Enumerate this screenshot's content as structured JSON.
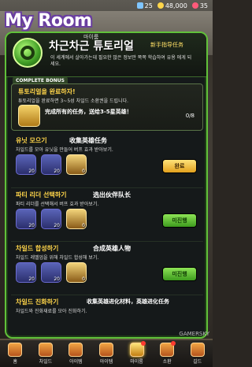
{
  "status": {
    "gems": "25",
    "gold": "48,000",
    "hearts": "35"
  },
  "header": {
    "logo": "My Room",
    "mini_label": "마이룸",
    "title": "차근차근 튜토리얼",
    "subtitle": "新手指导任务",
    "description": "이 세계에서 살아가는데 필요한 많은 정보만 쪽쪽 학습하여 유용 에게 되세요."
  },
  "complete_bonus": {
    "tag": "COMPLETE BONUS",
    "title": "튜토리얼을 완료하자!",
    "desc": "튜토리얼을 완료하면 3~5성 차일드 소환권을 드립니다.",
    "reward_text": "完成所有的任务，送给3-5星英雄！",
    "progress": "0/8"
  },
  "quests": [
    {
      "title": "유닛 모으기",
      "title_cn": "收集英雄任务",
      "desc": "차일드를 모아 유닛을 만들어 버프 효과 받아보기.",
      "rewards": [
        {
          "kind": "blue",
          "count": "20"
        },
        {
          "kind": "blue",
          "count": "20"
        },
        {
          "kind": "gold",
          "count": "0"
        }
      ],
      "button": "완료",
      "button_state": "done"
    },
    {
      "title": "파티 리더 선택하기",
      "title_cn": "选出伙伴队长",
      "desc": "파티 리더를 선택해서 버프 효과 받아보기.",
      "rewards": [
        {
          "kind": "blue",
          "count": "20"
        },
        {
          "kind": "blue",
          "count": "20"
        },
        {
          "kind": "gold",
          "count": "0"
        }
      ],
      "button": "미진행",
      "button_state": "progress"
    },
    {
      "title": "차일드 합성하기",
      "title_cn": "合成英雄人物",
      "desc": "차일드 레벨업을 위해 차일드 합성해 보기.",
      "rewards": [
        {
          "kind": "blue",
          "count": "20"
        },
        {
          "kind": "blue",
          "count": "20"
        },
        {
          "kind": "gold",
          "count": "0"
        }
      ],
      "button": "미진행",
      "button_state": "progress"
    },
    {
      "title": "차일드 진화하기",
      "title_cn": "收集英雄进化材料，英雄进化任务",
      "desc": "차일드와 진화재료를 모아 진화하기.",
      "rewards": [],
      "button": "",
      "button_state": ""
    }
  ],
  "nav": [
    {
      "label": "홈",
      "icon": "home-icon"
    },
    {
      "label": "차일드",
      "icon": "child-icon"
    },
    {
      "label": "아이템",
      "icon": "item-icon"
    },
    {
      "label": "아이템",
      "icon": "sword-icon"
    },
    {
      "label": "마이룸",
      "icon": "myroom-icon"
    },
    {
      "label": "소환",
      "icon": "summon-icon"
    },
    {
      "label": "길드",
      "icon": "guild-icon"
    }
  ],
  "watermark": "GAMERSKY"
}
